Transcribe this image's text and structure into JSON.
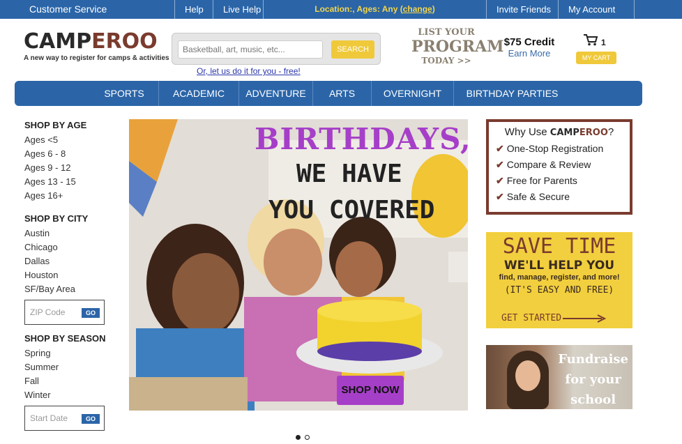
{
  "topbar": {
    "customer_service": "Customer Service",
    "help": "Help",
    "live_help": "Live Help",
    "location_prefix": "Location:, Ages: Any (",
    "location_change": "change",
    "location_suffix": ")",
    "invite": "Invite Friends",
    "account": "My Account"
  },
  "logo": {
    "part1": "CAMP",
    "part2": "EROO",
    "tagline": "A new way to register for camps & activities"
  },
  "search": {
    "placeholder": "Basketball, art, music, etc...",
    "button": "SEARCH",
    "alt_link": "Or, let us do it for you - free!"
  },
  "list_program": {
    "line1": "LIST YOUR",
    "line2": "PROGRAM",
    "line3": "TODAY >>"
  },
  "credit": {
    "amount": "$75 Credit",
    "earn": "Earn More"
  },
  "cart": {
    "count": "1",
    "button": "MY CART"
  },
  "nav": [
    "SPORTS",
    "ACADEMIC",
    "ADVENTURE",
    "ARTS",
    "OVERNIGHT",
    "BIRTHDAY PARTIES"
  ],
  "sidebar": {
    "age_title": "SHOP BY AGE",
    "ages": [
      "Ages <5",
      "Ages 6 - 8",
      "Ages 9 - 12",
      "Ages 13 - 15",
      "Ages 16+"
    ],
    "city_title": "SHOP BY CITY",
    "cities": [
      "Austin",
      "Chicago",
      "Dallas",
      "Houston",
      "SF/Bay Area"
    ],
    "zip_placeholder": "ZIP Code",
    "go": "GO",
    "season_title": "SHOP BY SEASON",
    "seasons": [
      "Spring",
      "Summer",
      "Fall",
      "Winter"
    ],
    "date_placeholder": "Start Date"
  },
  "hero": {
    "line1": "BIRTHDAYS,",
    "line2": "WE HAVE",
    "line3": "YOU COVERED",
    "button": "SHOP NOW"
  },
  "why": {
    "title_prefix": "Why Use ",
    "title_b1": "CAMP",
    "title_b2": "EROO",
    "title_suffix": "?",
    "items": [
      "One-Stop Registration",
      "Compare & Review",
      "Free for Parents",
      "Safe & Secure"
    ]
  },
  "save": {
    "title": "SAVE TIME",
    "sub": "WE'LL HELP YOU",
    "desc": "find, manage, register, and more!",
    "easy": "(IT'S EASY AND FREE)",
    "cta": "GET STARTED"
  },
  "fundraise": {
    "line1": "Fundraise",
    "line2": "for your",
    "line3": "school"
  },
  "colors": {
    "brand_blue": "#2b65a8",
    "accent_yellow": "#f0c93a",
    "brand_brown": "#7a3b2e",
    "purple": "#a63fc8"
  }
}
